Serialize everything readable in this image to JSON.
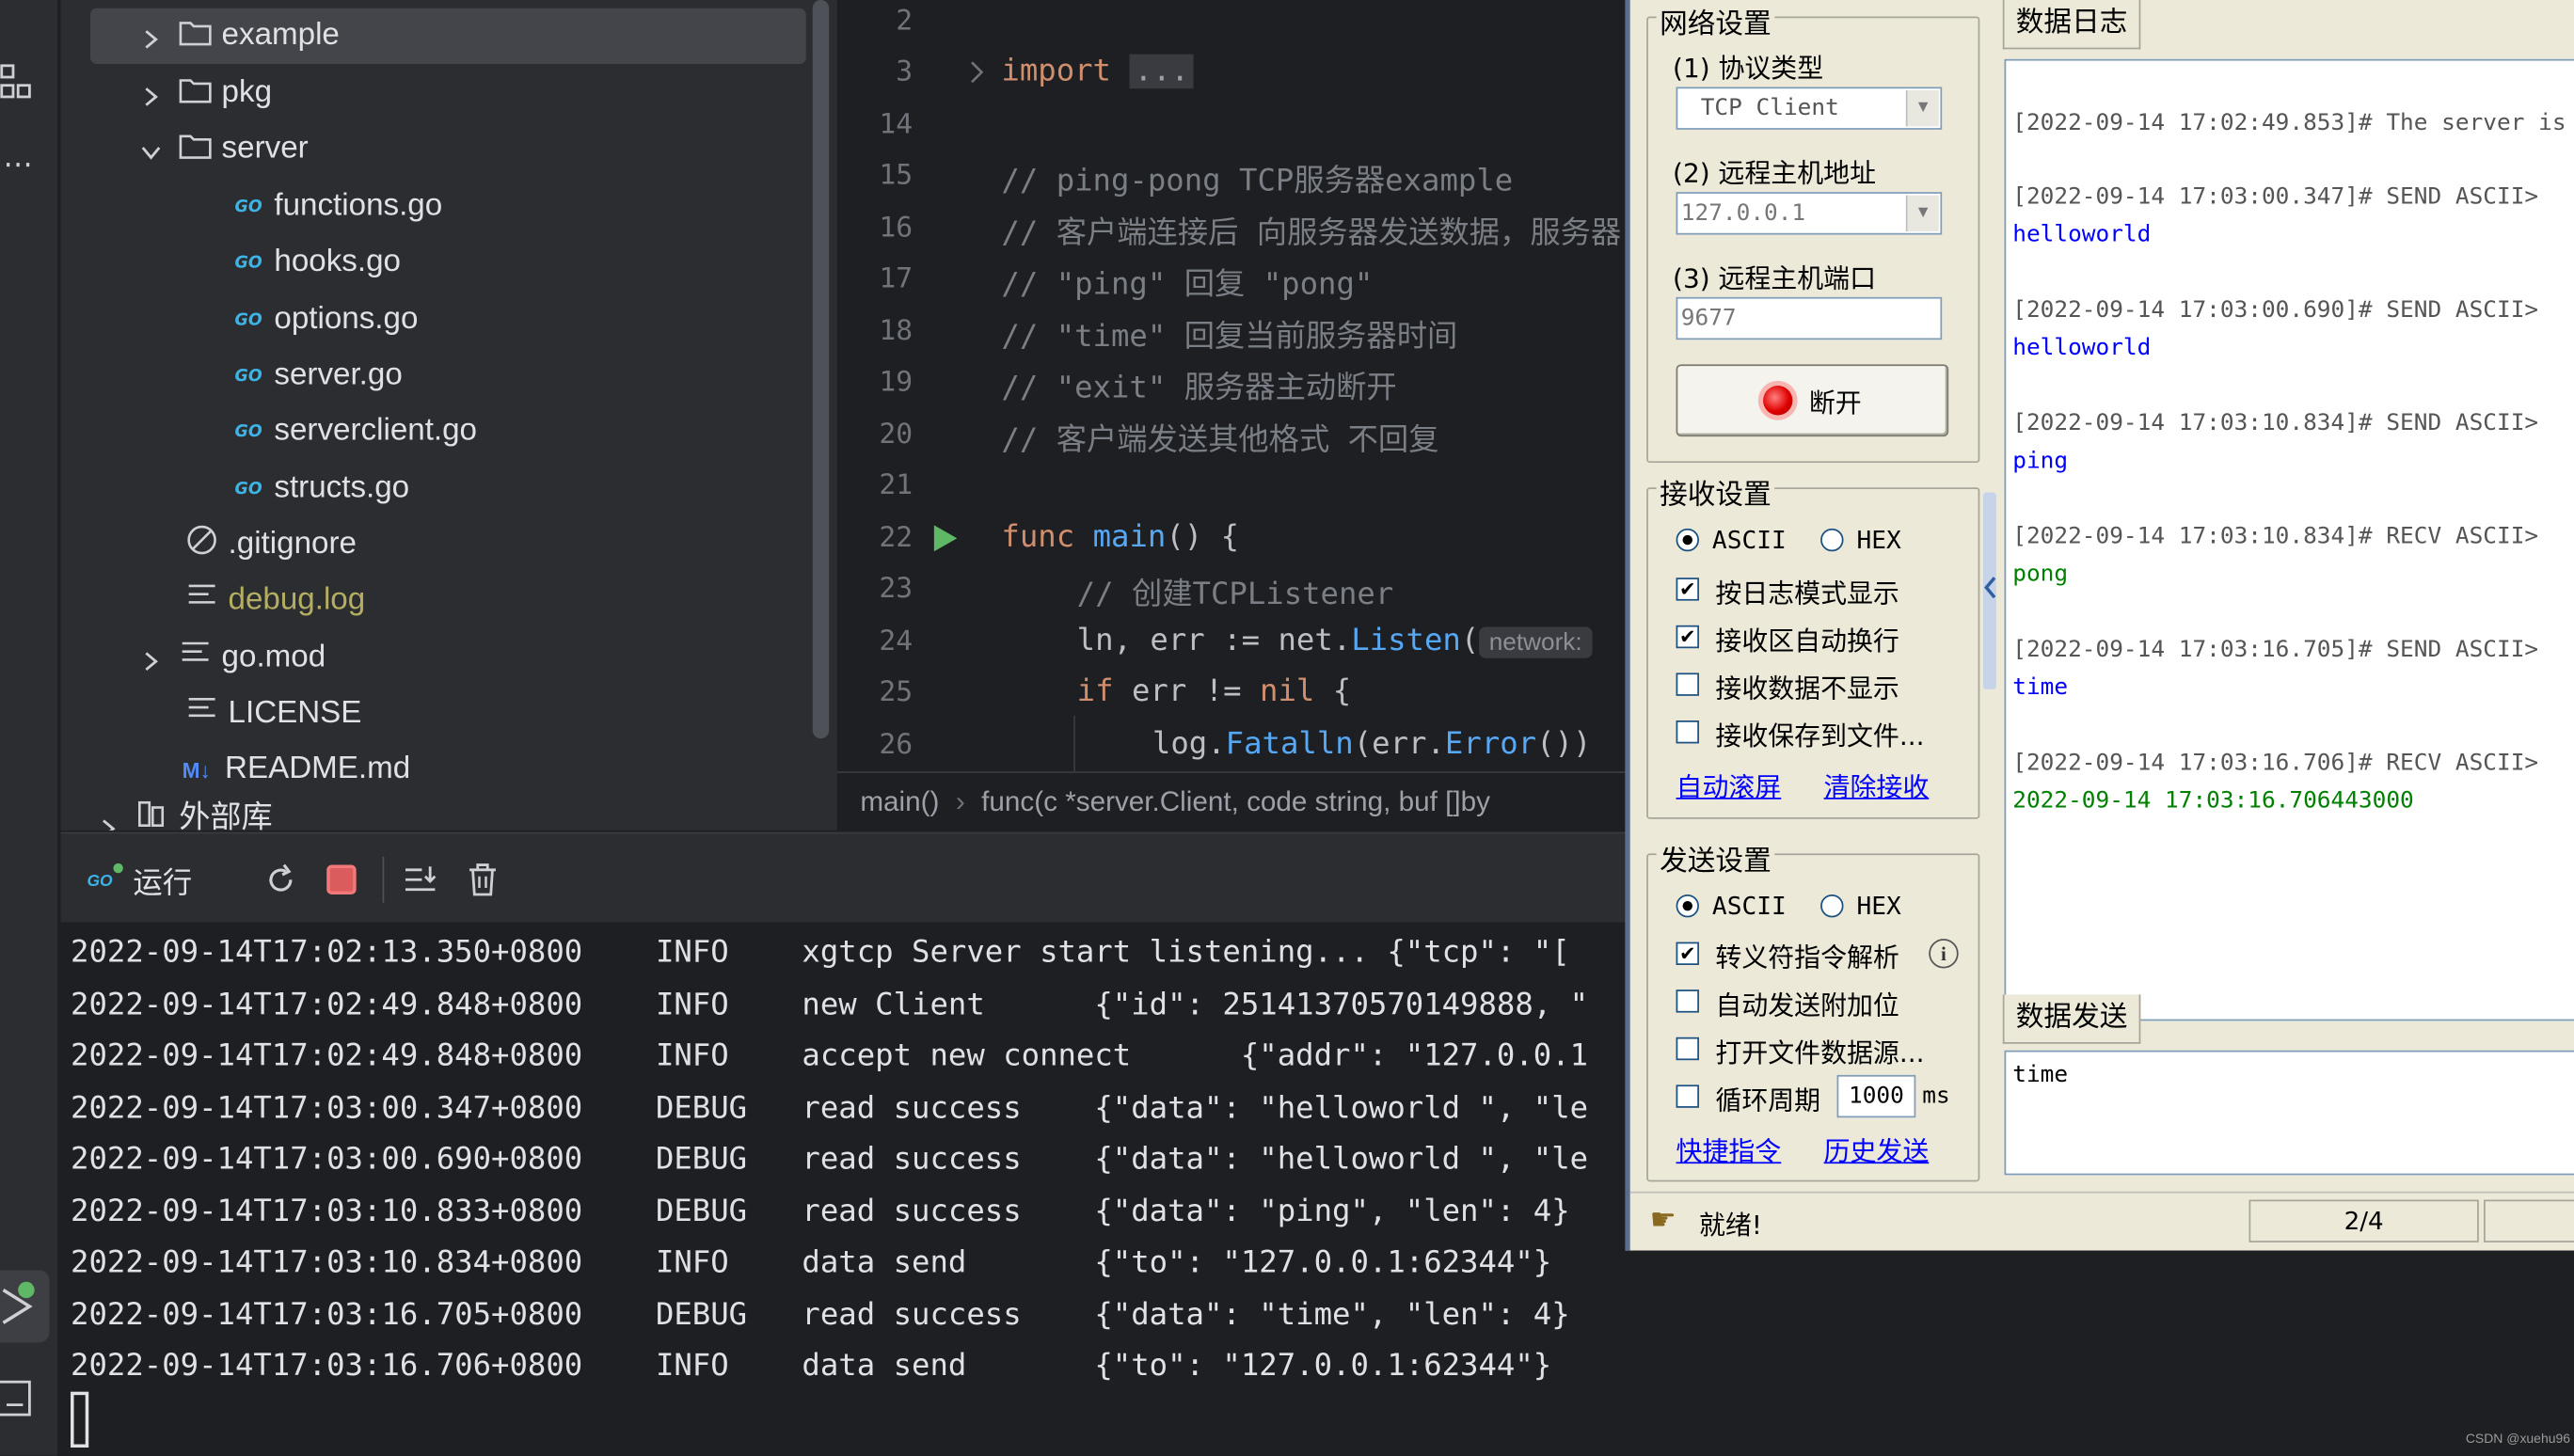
{
  "colors": {
    "ide_bg": "#1e1f22",
    "panel_bg": "#2b2d30",
    "tool_bg": "#ece9d8",
    "send_color": "#0000ff",
    "recv_color": "#008000",
    "keyword": "#cf8e6d",
    "comment": "#7a7e85",
    "func": "#56a8f5"
  },
  "tree": {
    "items": [
      {
        "label": "example",
        "icon": "folder-icon",
        "expandable": "collapsed"
      },
      {
        "label": "pkg",
        "icon": "folder-icon",
        "expandable": "collapsed"
      },
      {
        "label": "server",
        "icon": "folder-icon",
        "expandable": "expanded"
      },
      {
        "label": "functions.go",
        "icon": "go-file-icon"
      },
      {
        "label": "hooks.go",
        "icon": "go-file-icon"
      },
      {
        "label": "options.go",
        "icon": "go-file-icon"
      },
      {
        "label": "server.go",
        "icon": "go-file-icon"
      },
      {
        "label": "serverclient.go",
        "icon": "go-file-icon"
      },
      {
        "label": "structs.go",
        "icon": "go-file-icon"
      },
      {
        "label": ".gitignore",
        "icon": "ignore-file-icon"
      },
      {
        "label": "debug.log",
        "icon": "text-file-icon"
      },
      {
        "label": "go.mod",
        "icon": "text-file-icon",
        "expandable": "collapsed"
      },
      {
        "label": "LICENSE",
        "icon": "text-file-icon"
      },
      {
        "label": "README.md",
        "icon": "markdown-icon"
      },
      {
        "label": "外部库",
        "icon": "library-icon",
        "expandable": "collapsed"
      }
    ],
    "go_badge": "GO",
    "md_badge": "M↓"
  },
  "editor": {
    "line_numbers": [
      "2",
      "3",
      "14",
      "15",
      "16",
      "17",
      "18",
      "19",
      "20",
      "21",
      "22",
      "23",
      "24",
      "25",
      "26"
    ],
    "code": {
      "l3_kw": "import",
      "l3_fold": "...",
      "l15": "// ping-pong TCP服务器example",
      "l16": "// 客户端连接后 向服务器发送数据，服务器",
      "l17": "// \"ping\" 回复 \"pong\"",
      "l18": "// \"time\" 回复当前服务器时间",
      "l19": "// \"exit\" 服务器主动断开",
      "l20": "// 客户端发送其他格式 不回复",
      "l22_kw": "func",
      "l22_fn": "main",
      "l22_rest": "() {",
      "l23": "// 创建TCPListener",
      "l24_a": "ln, err := ",
      "l24_pkg": "net",
      "l24_dot": ".",
      "l24_fn": "Listen",
      "l24_paren": "(",
      "l24_hint": "network:",
      "l25_kw": "if",
      "l25_rest": " err != ",
      "l25_nil": "nil",
      "l25_brace": " {",
      "l26_pkg": "log",
      "l26_dot": ".",
      "l26_fn": "Fatalln",
      "l26_a": "(err.",
      "l26_fn2": "Error",
      "l26_b": "())"
    },
    "breadcrumb": {
      "a": "main()",
      "sep": "›",
      "b": "func(c *server.Client, code string, buf []by"
    }
  },
  "run": {
    "tab_label": "运行"
  },
  "console": {
    "lines": [
      "2022-09-14T17:02:13.350+0800    INFO    xgtcp Server start listening... {\"tcp\": \"[",
      "2022-09-14T17:02:49.848+0800    INFO    new Client      {\"id\": 25141370570149888, \"",
      "2022-09-14T17:02:49.848+0800    INFO    accept new connect      {\"addr\": \"127.0.0.1",
      "2022-09-14T17:03:00.347+0800    DEBUG   read success    {\"data\": \"helloworld \", \"le",
      "2022-09-14T17:03:00.690+0800    DEBUG   read success    {\"data\": \"helloworld \", \"le",
      "2022-09-14T17:03:10.833+0800    DEBUG   read success    {\"data\": \"ping\", \"len\": 4}",
      "2022-09-14T17:03:10.834+0800    INFO    data send       {\"to\": \"127.0.0.1:62344\"}",
      "2022-09-14T17:03:16.705+0800    DEBUG   read success    {\"data\": \"time\", \"len\": 4}",
      "2022-09-14T17:03:16.706+0800    INFO    data send       {\"to\": \"127.0.0.1:62344\"}"
    ]
  },
  "tool": {
    "net": {
      "title": "网络设置",
      "proto_label": "(1) 协议类型",
      "proto_value": "TCP Client",
      "host_label": "(2) 远程主机地址",
      "host_value": "127.0.0.1",
      "port_label": "(3) 远程主机端口",
      "port_value": "9677",
      "connect_button": "断开"
    },
    "recv": {
      "title": "接收设置",
      "ascii": "ASCII",
      "hex": "HEX",
      "opt1": "按日志模式显示",
      "opt2": "接收区自动换行",
      "opt3": "接收数据不显示",
      "opt4": "接收保存到文件...",
      "link1": "自动滚屏",
      "link2": "清除接收"
    },
    "send": {
      "title": "发送设置",
      "ascii": "ASCII",
      "hex": "HEX",
      "opt1": "转义符指令解析",
      "opt2": "自动发送附加位",
      "opt3": "打开文件数据源...",
      "opt4": "循环周期",
      "period": "1000",
      "unit": "ms",
      "link1": "快捷指令",
      "link2": "历史发送"
    },
    "log_tab": "数据日志",
    "log": [
      {
        "text": "[2022-09-14 17:02:49.853]# The server is",
        "kind": "meta"
      },
      {
        "text": "[2022-09-14 17:03:00.347]# SEND ASCII>",
        "kind": "meta"
      },
      {
        "text": "helloworld",
        "kind": "send"
      },
      {
        "text": "[2022-09-14 17:03:00.690]# SEND ASCII>",
        "kind": "meta"
      },
      {
        "text": "helloworld",
        "kind": "send"
      },
      {
        "text": "[2022-09-14 17:03:10.834]# SEND ASCII>",
        "kind": "meta"
      },
      {
        "text": "ping",
        "kind": "send"
      },
      {
        "text": "[2022-09-14 17:03:10.834]# RECV ASCII>",
        "kind": "meta"
      },
      {
        "text": "pong",
        "kind": "recv"
      },
      {
        "text": "[2022-09-14 17:03:16.705]# SEND ASCII>",
        "kind": "meta"
      },
      {
        "text": "time",
        "kind": "send"
      },
      {
        "text": "[2022-09-14 17:03:16.706]# RECV ASCII>",
        "kind": "meta"
      },
      {
        "text": "2022-09-14 17:03:16.706443000",
        "kind": "recv"
      }
    ],
    "send_tab": "数据发送",
    "send_text": "time",
    "status_text": "就绪!",
    "status_count": "2/4"
  },
  "watermark": "CSDN @xuehu96"
}
